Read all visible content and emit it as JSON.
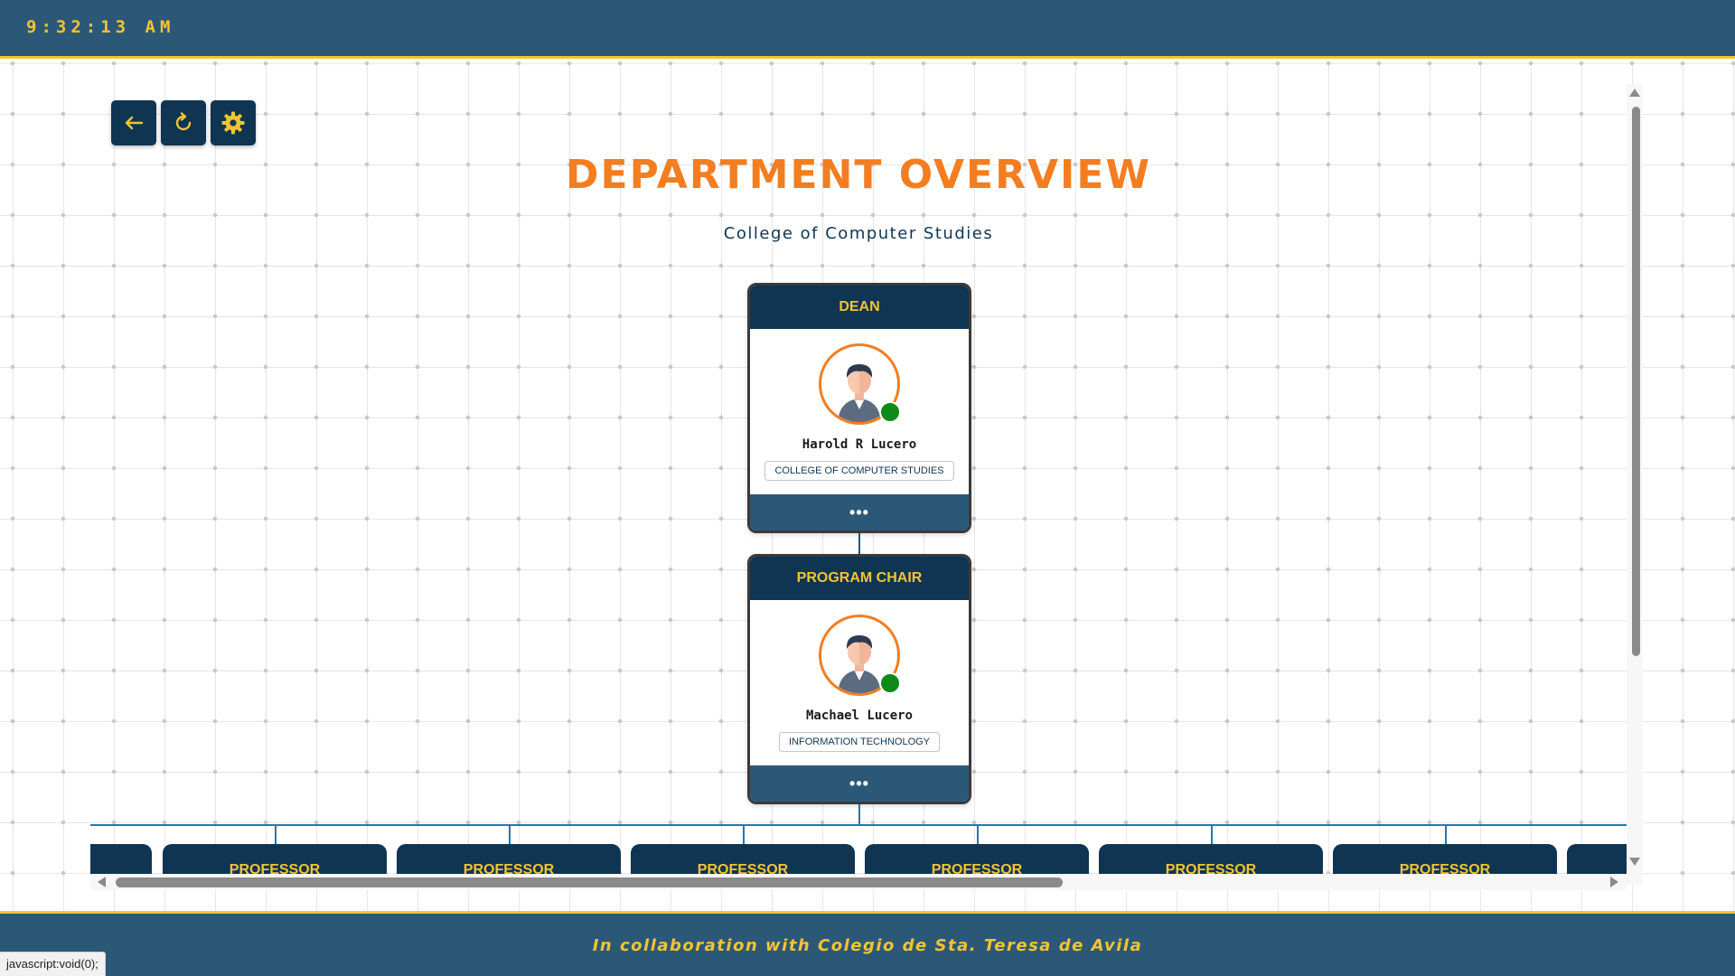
{
  "header": {
    "clock": "9:32:13 AM"
  },
  "toolbar": {
    "buttons": [
      {
        "name": "back",
        "icon": "arrow-left-icon"
      },
      {
        "name": "refresh",
        "icon": "refresh-icon"
      },
      {
        "name": "settings",
        "icon": "gear-icon"
      }
    ]
  },
  "page": {
    "title": "DEPARTMENT OVERVIEW",
    "subtitle": "College of Computer Studies"
  },
  "org": {
    "dean": {
      "role": "DEAN",
      "name": "Harold R Lucero",
      "department": "COLLEGE OF COMPUTER STUDIES",
      "more": "•••",
      "status": "online"
    },
    "program_chair": {
      "role": "PROGRAM CHAIR",
      "name": "Machael Lucero",
      "department": "INFORMATION TECHNOLOGY",
      "more": "•••",
      "status": "online"
    },
    "professors": [
      {
        "role": ""
      },
      {
        "role": "PROFESSOR"
      },
      {
        "role": "PROFESSOR"
      },
      {
        "role": "PROFESSOR"
      },
      {
        "role": "PROFESSOR"
      },
      {
        "role": "PROFESSOR"
      },
      {
        "role": "PROFESSOR"
      },
      {
        "role": ""
      }
    ]
  },
  "footer": {
    "text": "In collaboration with Colegio de Sta. Teresa de Avila"
  },
  "status_bar": {
    "url": "javascript:void(0);"
  },
  "colors": {
    "navy": "#0f3553",
    "header_blue": "#2c5878",
    "gold": "#f4c430",
    "orange": "#f47d20",
    "online_green": "#0f8a1a"
  }
}
